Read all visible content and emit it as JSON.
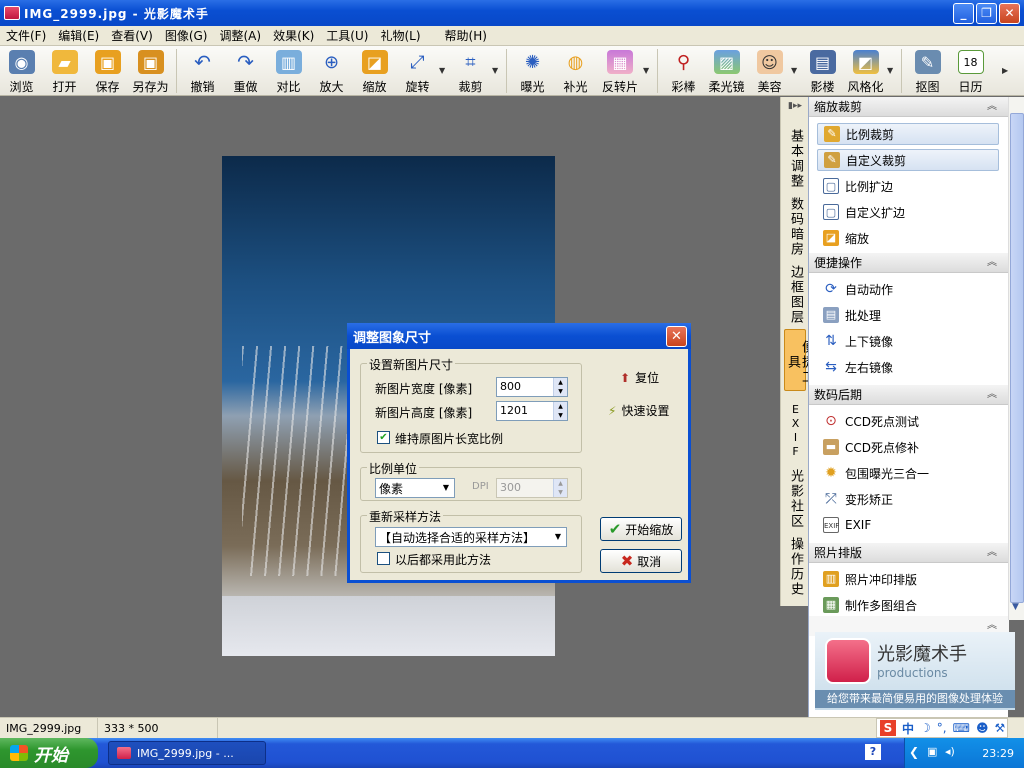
{
  "window": {
    "title": "IMG_2999.jpg - 光影魔术手"
  },
  "menu": [
    "文件(F)",
    "编辑(E)",
    "查看(V)",
    "图像(G)",
    "调整(A)",
    "效果(K)",
    "工具(U)",
    "礼物(L)",
    "帮助(H)"
  ],
  "toolbar": {
    "browse": "浏览",
    "open": "打开",
    "save": "保存",
    "save_as": "另存为",
    "undo": "撤销",
    "redo": "重做",
    "compare": "对比",
    "zoom_in": "放大",
    "resize": "缩放",
    "rotate": "旋转",
    "crop": "裁剪",
    "exposure": "曝光",
    "fill_light": "补光",
    "invert": "反转片",
    "color_wand": "彩棒",
    "soft_lens": "柔光镜",
    "beauty": "美容",
    "shadow": "影楼",
    "stylize": "风格化",
    "cutout": "抠图",
    "calendar": "日历"
  },
  "dialog": {
    "title": "调整图象尺寸",
    "group_new_size": "设置新图片尺寸",
    "width_label": "新图片宽度 [像素]",
    "width_value": "800",
    "height_label": "新图片高度 [像素]",
    "height_value": "1201",
    "keep_ratio": "维持原图片长宽比例",
    "group_unit": "比例单位",
    "unit_value": "像素",
    "dpi_label": "DPI",
    "dpi_value": "300",
    "group_resample": "重新采样方法",
    "resample_value": "【自动选择合适的采样方法】",
    "always_use": "以后都采用此方法",
    "reset": "复位",
    "quick_settings": "快速设置",
    "start": "开始缩放",
    "cancel": "取消"
  },
  "vtabs": [
    "基本调整",
    "数码暗房",
    "边框图层",
    "便捷工具",
    "EXIF",
    "光影社区",
    "操作历史"
  ],
  "panel": {
    "sec1": "缩放裁剪",
    "sec1_items": [
      "比例裁剪",
      "自定义裁剪",
      "比例扩边",
      "自定义扩边",
      "缩放"
    ],
    "sec2": "便捷操作",
    "sec2_items": [
      "自动动作",
      "批处理",
      "上下镜像",
      "左右镜像"
    ],
    "sec3": "数码后期",
    "sec3_items": [
      "CCD死点测试",
      "CCD死点修补",
      "包围曝光三合一",
      "变形矫正",
      "EXIF"
    ],
    "sec4": "照片排版",
    "sec4_items": [
      "照片冲印排版",
      "制作多图组合"
    ]
  },
  "banner": {
    "title": "光影魔术手",
    "subtitle": "productions",
    "tagline": "给您带来最简便易用的图像处理体验"
  },
  "status": {
    "file": "IMG_2999.jpg",
    "size": "333 * 500"
  },
  "taskbar": {
    "start": "开始",
    "task": "IMG_2999.jpg - ...",
    "time": "23:29"
  },
  "ime": {
    "label": "中"
  }
}
